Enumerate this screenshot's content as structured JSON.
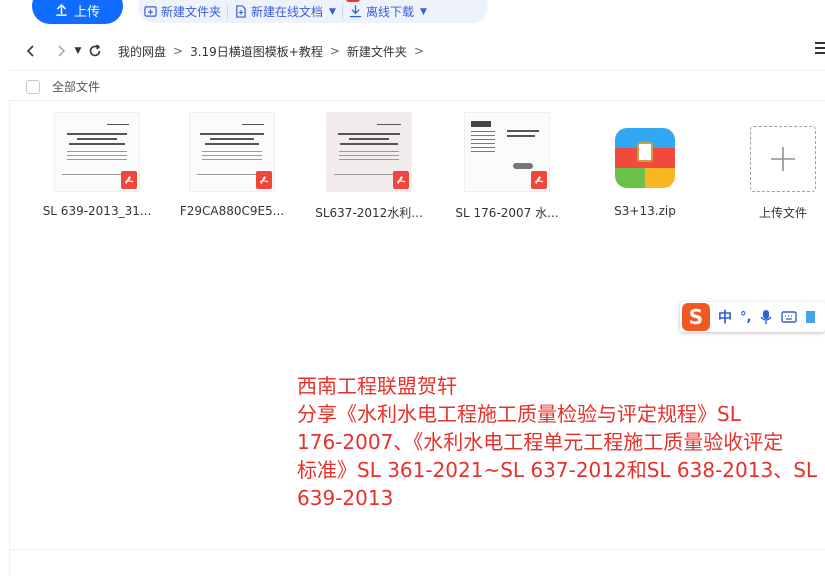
{
  "toolbar": {
    "upload_label": "上传",
    "new_folder_label": "新建文件夹",
    "new_online_doc_label": "新建在线文档",
    "offline_download_label": "离线下载"
  },
  "breadcrumb": {
    "items": [
      "我的网盘",
      "3.19日横道图模板+教程",
      "新建文件夹"
    ]
  },
  "list_header": {
    "all_files_label": "全部文件"
  },
  "files": [
    {
      "name": "SL 639-2013_31...",
      "type": "pdf"
    },
    {
      "name": "F29CA880C9E5...",
      "type": "pdf"
    },
    {
      "name": "SL637-2012水利...",
      "type": "pdf"
    },
    {
      "name": "SL 176-2007 水...",
      "type": "pdf"
    },
    {
      "name": "S3+13.zip",
      "type": "zip"
    }
  ],
  "upload_tile": {
    "label": "上传文件"
  },
  "ime": {
    "logo": "S",
    "mode": "中",
    "punct": "°,"
  },
  "overlay": {
    "lines": [
      "西南工程联盟贺轩",
      "分享《水利水电工程施工质量检验与评定规程》SL",
      "176-2007、《水利水电工程单元工程施工质量验收评定",
      "标准》SL 361-2021~SL 637-2012和SL 638-2013、SL",
      "639-2013"
    ]
  },
  "colors": {
    "accent": "#0f6cff",
    "overlay_text": "#e8302a",
    "pdf_badge": "#f0463c"
  }
}
